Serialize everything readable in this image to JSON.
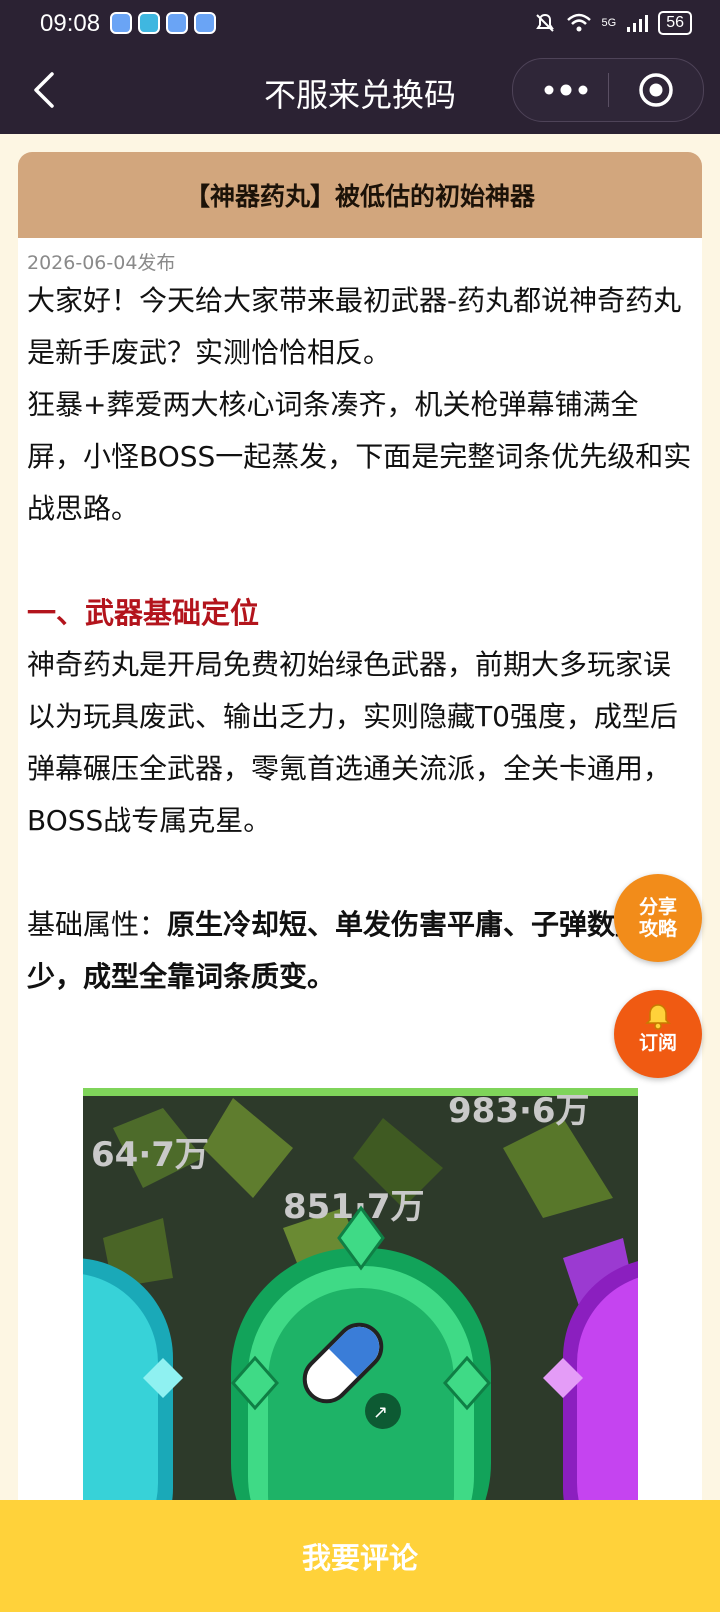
{
  "status": {
    "time": "09:08",
    "signal_label": "5G",
    "battery": "56"
  },
  "header": {
    "title": "不服来兑换码"
  },
  "article": {
    "heading": "【神器药丸】被低估的初始神器",
    "published": "2026-06-04发布",
    "intro_1": "大家好！今天给大家带来最初武器-药丸都说神奇药丸是新手废武？实测恰恰相反。",
    "intro_2": "狂暴+葬爱两大核心词条凑齐，机关枪弹幕铺满全屏，小怪BOSS一起蒸发，下面是完整词条优先级和实战思路。",
    "section_1_title": "一、武器基础定位",
    "section_1_body": "神奇药丸是开局免费初始绿色武器，前期大多玩家误以为玩具废武、输出乏力，实则隐藏T0强度，成型后弹幕碾压全武器，零氪首选通关流派，全关卡通用，BOSS战专属克星。",
    "attr_label": "基础属性：",
    "attr_bold": "原生冷却短、单发伤害平庸、子弹数量少，成型全靠词条质变。",
    "image_numbers": [
      "983·6万",
      "64·7万",
      "851·7万"
    ]
  },
  "fab": {
    "share": "分享攻略",
    "share_line1": "分享",
    "share_line2": "攻略",
    "subscribe": "订阅"
  },
  "bottom": {
    "comment": "我要评论"
  },
  "colors": {
    "header_bg": "#2b2233",
    "card_head": "#d2a67d",
    "section_red": "#b3141c",
    "bottom_bar": "#ffd23a",
    "fab_orange": "#f28c1a"
  }
}
